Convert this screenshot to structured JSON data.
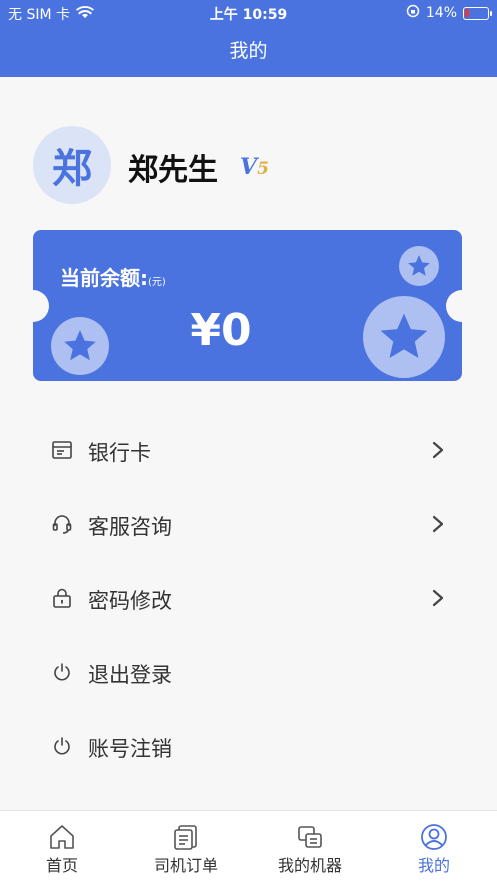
{
  "status_bar": {
    "carrier": "无 SIM 卡",
    "time": "上午 10:59",
    "battery": "14%"
  },
  "header": {
    "title": "我的"
  },
  "profile": {
    "avatar_text": "郑",
    "name": "郑先生",
    "vip_prefix": "V",
    "vip_level": "5"
  },
  "balance_card": {
    "label": "当前余额:",
    "unit": "(元)",
    "amount": "¥0"
  },
  "menu": {
    "items": [
      {
        "label": "银行卡",
        "icon": "bank-card-icon"
      },
      {
        "label": "客服咨询",
        "icon": "headset-icon"
      },
      {
        "label": "密码修改",
        "icon": "lock-icon"
      },
      {
        "label": "退出登录",
        "icon": "power-icon"
      },
      {
        "label": "账号注销",
        "icon": "power-icon"
      }
    ]
  },
  "tabbar": {
    "tabs": [
      {
        "label": "首页",
        "icon": "home-icon"
      },
      {
        "label": "司机订单",
        "icon": "order-icon"
      },
      {
        "label": "我的机器",
        "icon": "machine-icon"
      },
      {
        "label": "我的",
        "icon": "user-icon"
      }
    ],
    "active_index": 3
  },
  "colors": {
    "accent": "#4a73e0",
    "vip_number": "#e0b040",
    "background": "#f7f7f7"
  }
}
